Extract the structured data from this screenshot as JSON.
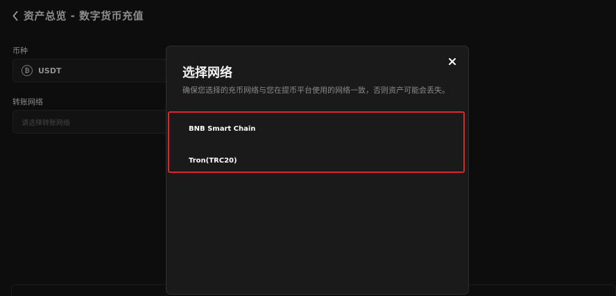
{
  "header": {
    "title": "资产总览 - 数字货币充值"
  },
  "form": {
    "coin_label": "币种",
    "coin_value": "USDT",
    "network_label": "转账网络",
    "network_placeholder": "请选择转账网络"
  },
  "modal": {
    "title": "选择网络",
    "description": "确保您选择的充币网络与您在提币平台使用的网络一致，否则资产可能会丢失。",
    "options": [
      {
        "label": "BNB Smart Chain"
      },
      {
        "label": "Tron(TRC20)"
      }
    ]
  },
  "icons": {
    "back": "chevron-left-icon",
    "coin": "bitcoin-icon",
    "close": "close-icon"
  },
  "colors": {
    "background": "#0d0d0d",
    "modal_background": "#1a1a1a",
    "highlight_border": "#e0262a",
    "text_primary": "#ffffff",
    "text_secondary": "#8a8a8a"
  }
}
